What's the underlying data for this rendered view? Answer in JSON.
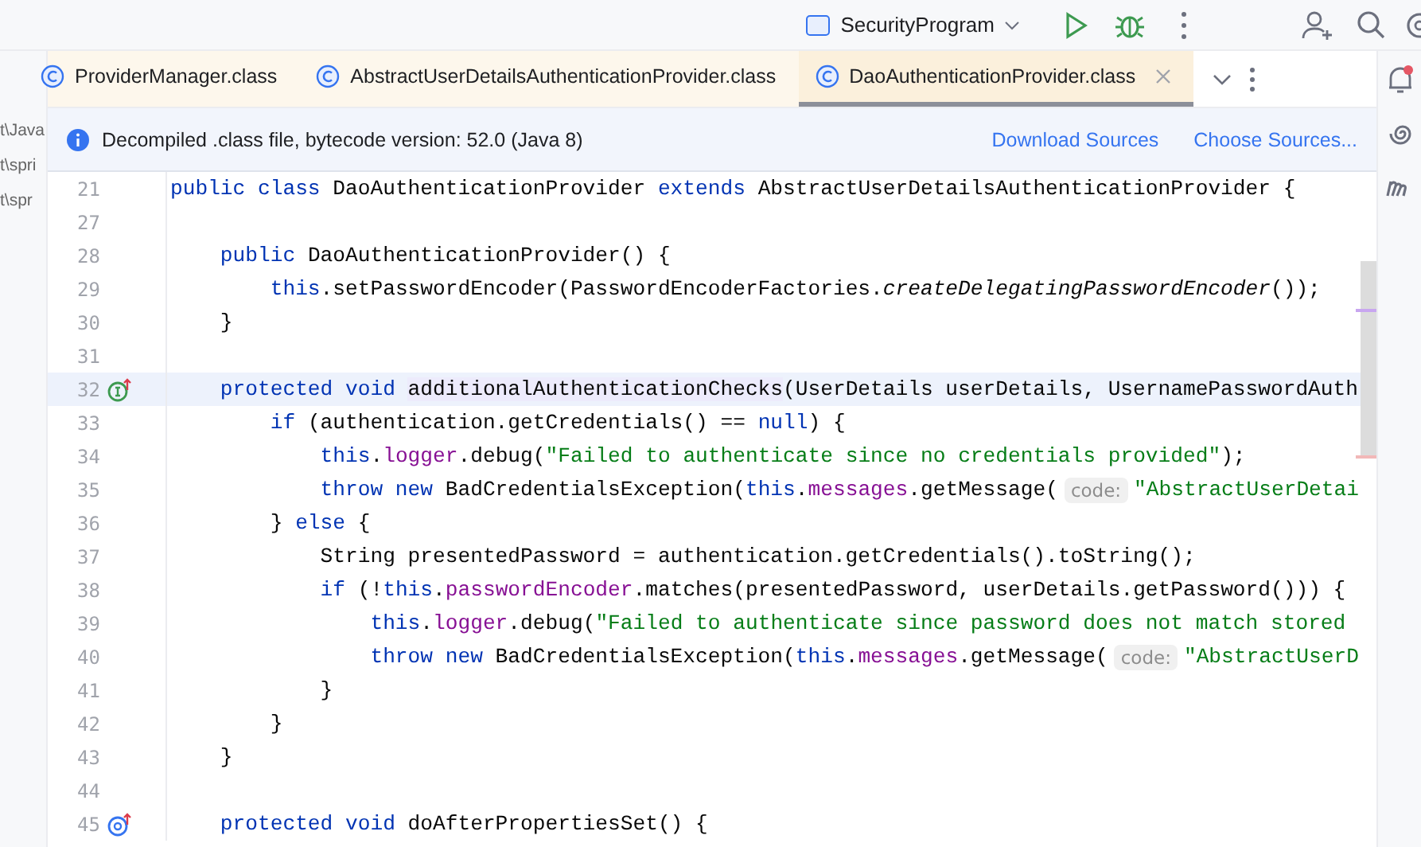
{
  "toolbar": {
    "run_config": "SecurityProgram"
  },
  "sidebar": {
    "items": [
      "t\\Java",
      "t\\spri",
      "t\\spr"
    ]
  },
  "tabs": [
    {
      "label": "ProviderManager.class",
      "selected": false
    },
    {
      "label": "AbstractUserDetailsAuthenticationProvider.class",
      "selected": false
    },
    {
      "label": "DaoAuthenticationProvider.class",
      "selected": true
    }
  ],
  "banner": {
    "message": "Decompiled .class file, bytecode version: 52.0 (Java 8)",
    "links": [
      "Download Sources",
      "Choose Sources..."
    ]
  },
  "editor": {
    "lines": [
      {
        "number": "21",
        "current": false,
        "tokens": [
          {
            "kind": "keyword",
            "text": "public class "
          },
          {
            "kind": "plain",
            "text": "DaoAuthenticationProvider "
          },
          {
            "kind": "keyword",
            "text": "extends "
          },
          {
            "kind": "plain",
            "text": "AbstractUserDetailsAuthenticationProvider {"
          }
        ]
      },
      {
        "number": "27",
        "current": false
      },
      {
        "number": "28",
        "current": false,
        "tokens": [
          {
            "kind": "keyword",
            "text": "    public "
          },
          {
            "kind": "plain",
            "text": "DaoAuthenticationProvider() {"
          }
        ]
      },
      {
        "number": "29",
        "current": false,
        "tokens": [
          {
            "kind": "keyword",
            "text": "        this"
          },
          {
            "kind": "plain",
            "text": ".setPasswordEncoder(PasswordEncoderFactories."
          },
          {
            "kind": "static_call",
            "text": "createDelegatingPasswordEncoder"
          },
          {
            "kind": "plain",
            "text": "());"
          }
        ]
      },
      {
        "number": "30",
        "current": false,
        "tokens": [
          {
            "kind": "plain",
            "text": "    }"
          }
        ]
      },
      {
        "number": "31",
        "current": false
      },
      {
        "number": "32",
        "current": true,
        "gutter_marker": {
          "kind": "implements"
        },
        "tokens": [
          {
            "kind": "keyword",
            "text": "    protected void "
          },
          {
            "kind": "usage",
            "text": "additionalAuthenticationChecks"
          },
          {
            "kind": "plain",
            "text": "(UserDetails userDetails, UsernamePasswordAuth"
          }
        ]
      },
      {
        "number": "33",
        "current": false,
        "tokens": [
          {
            "kind": "keyword",
            "text": "        if "
          },
          {
            "kind": "plain",
            "text": "(authentication.getCredentials() == "
          },
          {
            "kind": "keyword",
            "text": "null"
          },
          {
            "kind": "plain",
            "text": ") {"
          }
        ]
      },
      {
        "number": "34",
        "current": false,
        "tokens": [
          {
            "kind": "keyword",
            "text": "            this"
          },
          {
            "kind": "plain",
            "text": "."
          },
          {
            "kind": "field",
            "text": "logger"
          },
          {
            "kind": "plain",
            "text": ".debug("
          },
          {
            "kind": "string",
            "text": "\"Failed to authenticate since no credentials provided\""
          },
          {
            "kind": "plain",
            "text": ");"
          }
        ]
      },
      {
        "number": "35",
        "current": false,
        "tokens": [
          {
            "kind": "keyword",
            "text": "            throw new "
          },
          {
            "kind": "plain",
            "text": "BadCredentialsException("
          },
          {
            "kind": "keyword",
            "text": "this"
          },
          {
            "kind": "plain",
            "text": "."
          },
          {
            "kind": "field",
            "text": "messages"
          },
          {
            "kind": "plain",
            "text": ".getMessage("
          },
          {
            "kind": "hint",
            "text": "code:"
          },
          {
            "kind": "string",
            "text": "\"AbstractUserDetai"
          }
        ]
      },
      {
        "number": "36",
        "current": false,
        "tokens": [
          {
            "kind": "plain",
            "text": "        } "
          },
          {
            "kind": "keyword",
            "text": "else "
          },
          {
            "kind": "plain",
            "text": "{"
          }
        ]
      },
      {
        "number": "37",
        "current": false,
        "tokens": [
          {
            "kind": "plain",
            "text": "            String presentedPassword = authentication.getCredentials().toString();"
          }
        ]
      },
      {
        "number": "38",
        "current": false,
        "tokens": [
          {
            "kind": "keyword",
            "text": "            if "
          },
          {
            "kind": "plain",
            "text": "(!"
          },
          {
            "kind": "keyword",
            "text": "this"
          },
          {
            "kind": "plain",
            "text": "."
          },
          {
            "kind": "field",
            "text": "passwordEncoder"
          },
          {
            "kind": "plain",
            "text": ".matches(presentedPassword, userDetails.getPassword())) {"
          }
        ]
      },
      {
        "number": "39",
        "current": false,
        "tokens": [
          {
            "kind": "keyword",
            "text": "                this"
          },
          {
            "kind": "plain",
            "text": "."
          },
          {
            "kind": "field",
            "text": "logger"
          },
          {
            "kind": "plain",
            "text": ".debug("
          },
          {
            "kind": "string",
            "text": "\"Failed to authenticate since password does not match stored"
          }
        ]
      },
      {
        "number": "40",
        "current": false,
        "tokens": [
          {
            "kind": "keyword",
            "text": "                throw new "
          },
          {
            "kind": "plain",
            "text": "BadCredentialsException("
          },
          {
            "kind": "keyword",
            "text": "this"
          },
          {
            "kind": "plain",
            "text": "."
          },
          {
            "kind": "field",
            "text": "messages"
          },
          {
            "kind": "plain",
            "text": ".getMessage("
          },
          {
            "kind": "hint",
            "text": "code:"
          },
          {
            "kind": "string",
            "text": "\"AbstractUserD"
          }
        ]
      },
      {
        "number": "41",
        "current": false,
        "tokens": [
          {
            "kind": "plain",
            "text": "            }"
          }
        ]
      },
      {
        "number": "42",
        "current": false,
        "tokens": [
          {
            "kind": "plain",
            "text": "        }"
          }
        ]
      },
      {
        "number": "43",
        "current": false,
        "tokens": [
          {
            "kind": "plain",
            "text": "    }"
          }
        ]
      },
      {
        "number": "44",
        "current": false
      },
      {
        "number": "45",
        "current": false,
        "gutter_marker": {
          "kind": "overrides"
        },
        "tokens": [
          {
            "kind": "keyword",
            "text": "    protected void "
          },
          {
            "kind": "plain",
            "text": "doAfterPropertiesSet() {"
          }
        ]
      }
    ]
  }
}
